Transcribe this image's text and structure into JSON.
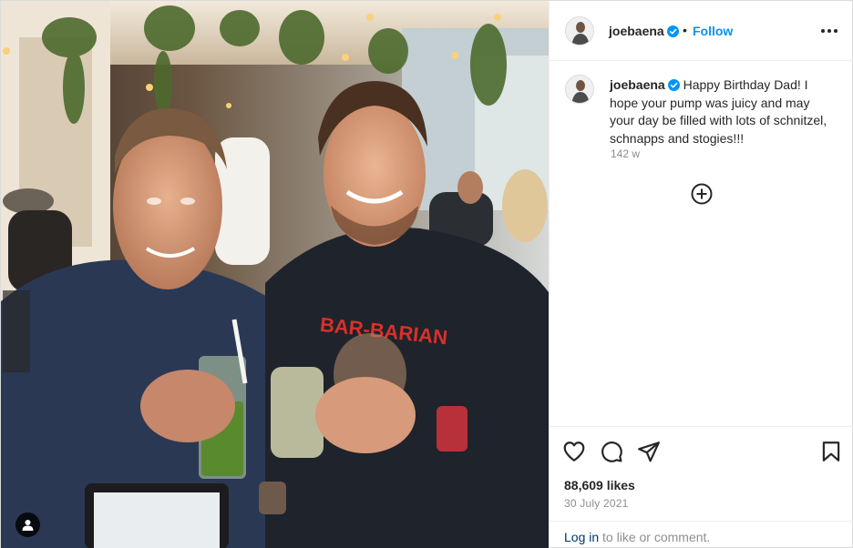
{
  "post": {
    "username": "joebaena",
    "follow_label": "Follow",
    "separator": "•",
    "caption": "Happy Birthday Dad! I hope your pump was juicy and may your day be filled with lots of schnitzel, schnapps and stogies!!!",
    "caption_time": "142 w",
    "likes": "88,609 likes",
    "date": "30 July 2021",
    "login_link": "Log in",
    "login_suffix": " to like or comment.",
    "shirt_text": "BAR-BARIAN"
  },
  "icons": {
    "verified": "verified-badge-icon",
    "more": "more-options-icon",
    "load_more": "add-circle-icon",
    "like": "heart-icon",
    "comment": "comment-icon",
    "share": "paper-plane-icon",
    "save": "bookmark-icon",
    "user_tag": "person-tag-icon"
  },
  "colors": {
    "accent": "#0095f6",
    "verified": "#0095f6",
    "text": "#262626",
    "muted": "#8e8e8e",
    "link": "#00376b",
    "border": "#efefef"
  }
}
